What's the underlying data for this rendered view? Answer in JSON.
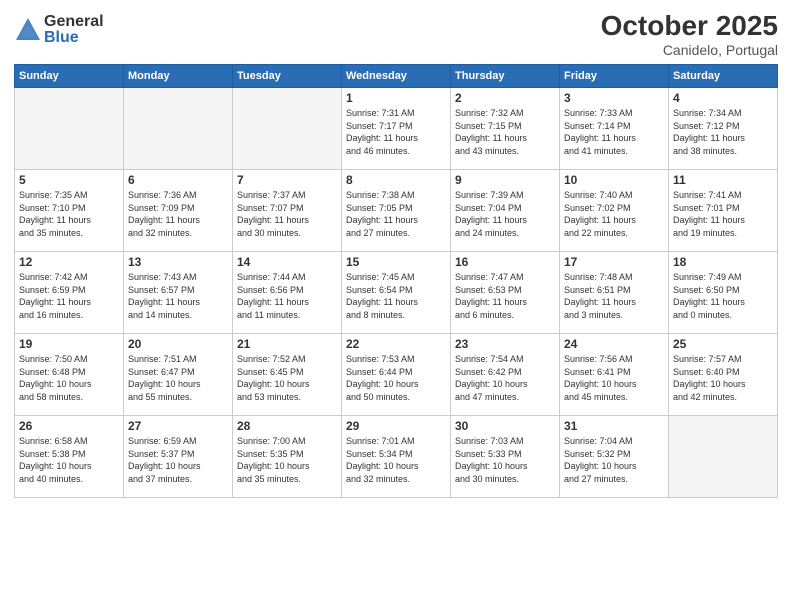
{
  "logo": {
    "general": "General",
    "blue": "Blue"
  },
  "header": {
    "month": "October 2025",
    "location": "Canidelo, Portugal"
  },
  "weekdays": [
    "Sunday",
    "Monday",
    "Tuesday",
    "Wednesday",
    "Thursday",
    "Friday",
    "Saturday"
  ],
  "weeks": [
    [
      {
        "day": "",
        "info": ""
      },
      {
        "day": "",
        "info": ""
      },
      {
        "day": "",
        "info": ""
      },
      {
        "day": "1",
        "info": "Sunrise: 7:31 AM\nSunset: 7:17 PM\nDaylight: 11 hours\nand 46 minutes."
      },
      {
        "day": "2",
        "info": "Sunrise: 7:32 AM\nSunset: 7:15 PM\nDaylight: 11 hours\nand 43 minutes."
      },
      {
        "day": "3",
        "info": "Sunrise: 7:33 AM\nSunset: 7:14 PM\nDaylight: 11 hours\nand 41 minutes."
      },
      {
        "day": "4",
        "info": "Sunrise: 7:34 AM\nSunset: 7:12 PM\nDaylight: 11 hours\nand 38 minutes."
      }
    ],
    [
      {
        "day": "5",
        "info": "Sunrise: 7:35 AM\nSunset: 7:10 PM\nDaylight: 11 hours\nand 35 minutes."
      },
      {
        "day": "6",
        "info": "Sunrise: 7:36 AM\nSunset: 7:09 PM\nDaylight: 11 hours\nand 32 minutes."
      },
      {
        "day": "7",
        "info": "Sunrise: 7:37 AM\nSunset: 7:07 PM\nDaylight: 11 hours\nand 30 minutes."
      },
      {
        "day": "8",
        "info": "Sunrise: 7:38 AM\nSunset: 7:05 PM\nDaylight: 11 hours\nand 27 minutes."
      },
      {
        "day": "9",
        "info": "Sunrise: 7:39 AM\nSunset: 7:04 PM\nDaylight: 11 hours\nand 24 minutes."
      },
      {
        "day": "10",
        "info": "Sunrise: 7:40 AM\nSunset: 7:02 PM\nDaylight: 11 hours\nand 22 minutes."
      },
      {
        "day": "11",
        "info": "Sunrise: 7:41 AM\nSunset: 7:01 PM\nDaylight: 11 hours\nand 19 minutes."
      }
    ],
    [
      {
        "day": "12",
        "info": "Sunrise: 7:42 AM\nSunset: 6:59 PM\nDaylight: 11 hours\nand 16 minutes."
      },
      {
        "day": "13",
        "info": "Sunrise: 7:43 AM\nSunset: 6:57 PM\nDaylight: 11 hours\nand 14 minutes."
      },
      {
        "day": "14",
        "info": "Sunrise: 7:44 AM\nSunset: 6:56 PM\nDaylight: 11 hours\nand 11 minutes."
      },
      {
        "day": "15",
        "info": "Sunrise: 7:45 AM\nSunset: 6:54 PM\nDaylight: 11 hours\nand 8 minutes."
      },
      {
        "day": "16",
        "info": "Sunrise: 7:47 AM\nSunset: 6:53 PM\nDaylight: 11 hours\nand 6 minutes."
      },
      {
        "day": "17",
        "info": "Sunrise: 7:48 AM\nSunset: 6:51 PM\nDaylight: 11 hours\nand 3 minutes."
      },
      {
        "day": "18",
        "info": "Sunrise: 7:49 AM\nSunset: 6:50 PM\nDaylight: 11 hours\nand 0 minutes."
      }
    ],
    [
      {
        "day": "19",
        "info": "Sunrise: 7:50 AM\nSunset: 6:48 PM\nDaylight: 10 hours\nand 58 minutes."
      },
      {
        "day": "20",
        "info": "Sunrise: 7:51 AM\nSunset: 6:47 PM\nDaylight: 10 hours\nand 55 minutes."
      },
      {
        "day": "21",
        "info": "Sunrise: 7:52 AM\nSunset: 6:45 PM\nDaylight: 10 hours\nand 53 minutes."
      },
      {
        "day": "22",
        "info": "Sunrise: 7:53 AM\nSunset: 6:44 PM\nDaylight: 10 hours\nand 50 minutes."
      },
      {
        "day": "23",
        "info": "Sunrise: 7:54 AM\nSunset: 6:42 PM\nDaylight: 10 hours\nand 47 minutes."
      },
      {
        "day": "24",
        "info": "Sunrise: 7:56 AM\nSunset: 6:41 PM\nDaylight: 10 hours\nand 45 minutes."
      },
      {
        "day": "25",
        "info": "Sunrise: 7:57 AM\nSunset: 6:40 PM\nDaylight: 10 hours\nand 42 minutes."
      }
    ],
    [
      {
        "day": "26",
        "info": "Sunrise: 6:58 AM\nSunset: 5:38 PM\nDaylight: 10 hours\nand 40 minutes."
      },
      {
        "day": "27",
        "info": "Sunrise: 6:59 AM\nSunset: 5:37 PM\nDaylight: 10 hours\nand 37 minutes."
      },
      {
        "day": "28",
        "info": "Sunrise: 7:00 AM\nSunset: 5:35 PM\nDaylight: 10 hours\nand 35 minutes."
      },
      {
        "day": "29",
        "info": "Sunrise: 7:01 AM\nSunset: 5:34 PM\nDaylight: 10 hours\nand 32 minutes."
      },
      {
        "day": "30",
        "info": "Sunrise: 7:03 AM\nSunset: 5:33 PM\nDaylight: 10 hours\nand 30 minutes."
      },
      {
        "day": "31",
        "info": "Sunrise: 7:04 AM\nSunset: 5:32 PM\nDaylight: 10 hours\nand 27 minutes."
      },
      {
        "day": "",
        "info": ""
      }
    ]
  ]
}
